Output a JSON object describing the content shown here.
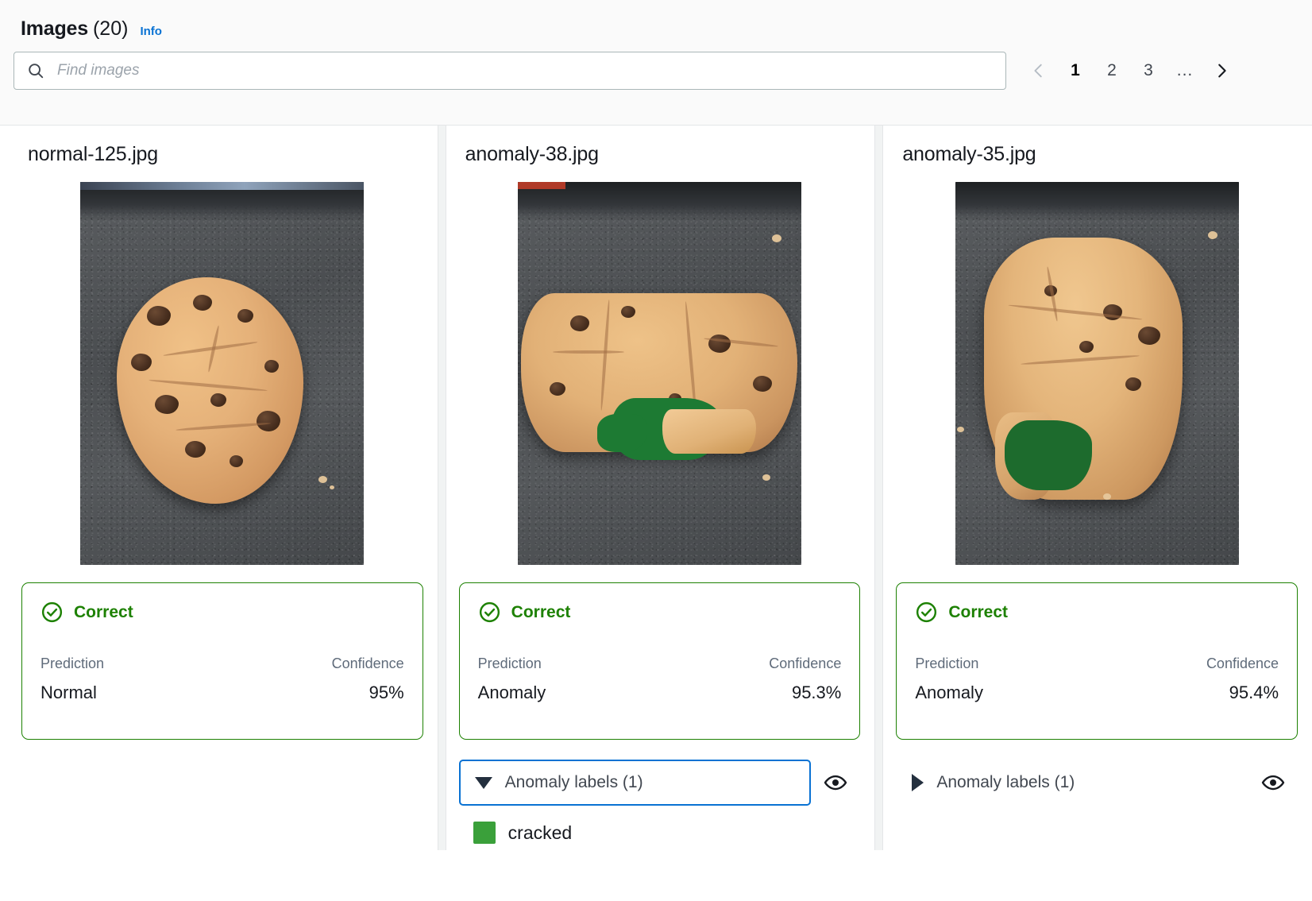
{
  "header": {
    "title": "Images",
    "count": "(20)",
    "info_label": "Info"
  },
  "search": {
    "placeholder": "Find images",
    "value": "",
    "icon": "search-icon"
  },
  "pagination": {
    "prev_icon": "chevron-left-icon",
    "next_icon": "chevron-right-icon",
    "pages": [
      "1",
      "2",
      "3"
    ],
    "ellipsis": "...",
    "current": "1"
  },
  "labels_section": {
    "prediction_header": "Prediction",
    "confidence_header": "Confidence",
    "eye_icon": "eye-icon"
  },
  "cards": [
    {
      "filename": "normal-125.jpg",
      "status": "Correct",
      "status_icon": "check-circle-icon",
      "status_color": "#1d8102",
      "prediction_label": "Prediction",
      "prediction_value": "Normal",
      "confidence_label": "Confidence",
      "confidence_value": "95%",
      "has_anomaly_labels": false,
      "anomaly_labels_toggle": "",
      "anomaly_labels_expanded": false,
      "anomaly_labels_focused": false,
      "anomaly_label_name": "",
      "anomaly_label_color": ""
    },
    {
      "filename": "anomaly-38.jpg",
      "status": "Correct",
      "status_icon": "check-circle-icon",
      "status_color": "#1d8102",
      "prediction_label": "Prediction",
      "prediction_value": "Anomaly",
      "confidence_label": "Confidence",
      "confidence_value": "95.3%",
      "has_anomaly_labels": true,
      "anomaly_labels_toggle": "Anomaly labels (1)",
      "anomaly_labels_expanded": true,
      "anomaly_labels_focused": true,
      "anomaly_label_name": "cracked",
      "anomaly_label_color": "#3aa03a"
    },
    {
      "filename": "anomaly-35.jpg",
      "status": "Correct",
      "status_icon": "check-circle-icon",
      "status_color": "#1d8102",
      "prediction_label": "Prediction",
      "prediction_value": "Anomaly",
      "confidence_label": "Confidence",
      "confidence_value": "95.4%",
      "has_anomaly_labels": true,
      "anomaly_labels_toggle": "Anomaly labels (1)",
      "anomaly_labels_expanded": false,
      "anomaly_labels_focused": false,
      "anomaly_label_name": "",
      "anomaly_label_color": ""
    }
  ]
}
